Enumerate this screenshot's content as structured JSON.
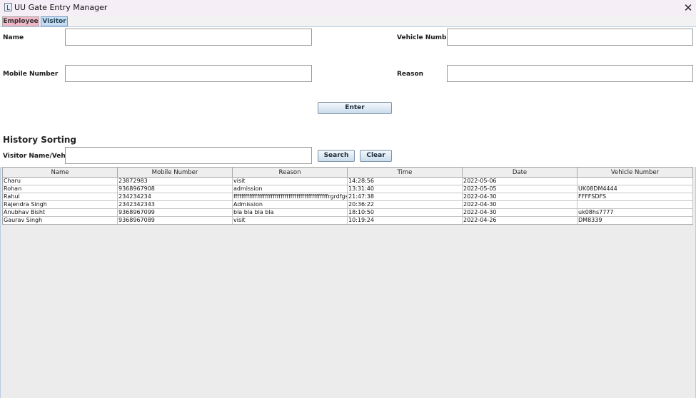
{
  "window": {
    "title": "UU Gate Entry Manager",
    "close_symbol": "✕"
  },
  "tabs": {
    "employee": "Employee",
    "visitor": "Visitor"
  },
  "form": {
    "name_label": "Name",
    "name_value": "",
    "vehicle_label": "Vehicle Number",
    "vehicle_value": "",
    "mobile_label": "Mobile Number",
    "mobile_value": "",
    "reason_label": "Reason",
    "reason_value": "",
    "enter_button": "Enter"
  },
  "history": {
    "title": "History Sorting",
    "search_label": "Visitor Name/Vehicle",
    "search_value": "",
    "search_button": "Search",
    "clear_button": "Clear"
  },
  "table": {
    "columns": [
      "Name",
      "Mobile Number",
      "Reason",
      "Time",
      "Date",
      "Vehicle Number"
    ],
    "rows": [
      [
        "Charu",
        "23872983",
        "visit",
        "14:28:56",
        "2022-05-06",
        ""
      ],
      [
        "Rohan",
        "9368967908",
        "admission",
        "13:31:40",
        "2022-05-05",
        "UK08DM4444"
      ],
      [
        "Rahul",
        "234234234",
        "ffffffffffffffffffffffffffffffffffffffffffffffffrgrdfgsdfgsdfg",
        "21:47:38",
        "2022-04-30",
        "FFFFSDFS"
      ],
      [
        "Rajendra Singh",
        "2342342343",
        "Admission",
        "20:36:22",
        "2022-04-30",
        ""
      ],
      [
        "Anubhav Bisht",
        "9368967099",
        "bla bla bla bla",
        "18:10:50",
        "2022-04-30",
        "uk08hs7777"
      ],
      [
        "Gaurav Singh",
        "9368967089",
        "visit",
        "10:19:24",
        "2022-04-26",
        "DM8339"
      ]
    ]
  },
  "colors": {
    "titlebar": "#f6eef6",
    "employee_tab": "#f2b8c8",
    "visitor_tab": "#c8ddf2",
    "panel_bg": "#ececec",
    "panel_border": "#b8cde2"
  }
}
